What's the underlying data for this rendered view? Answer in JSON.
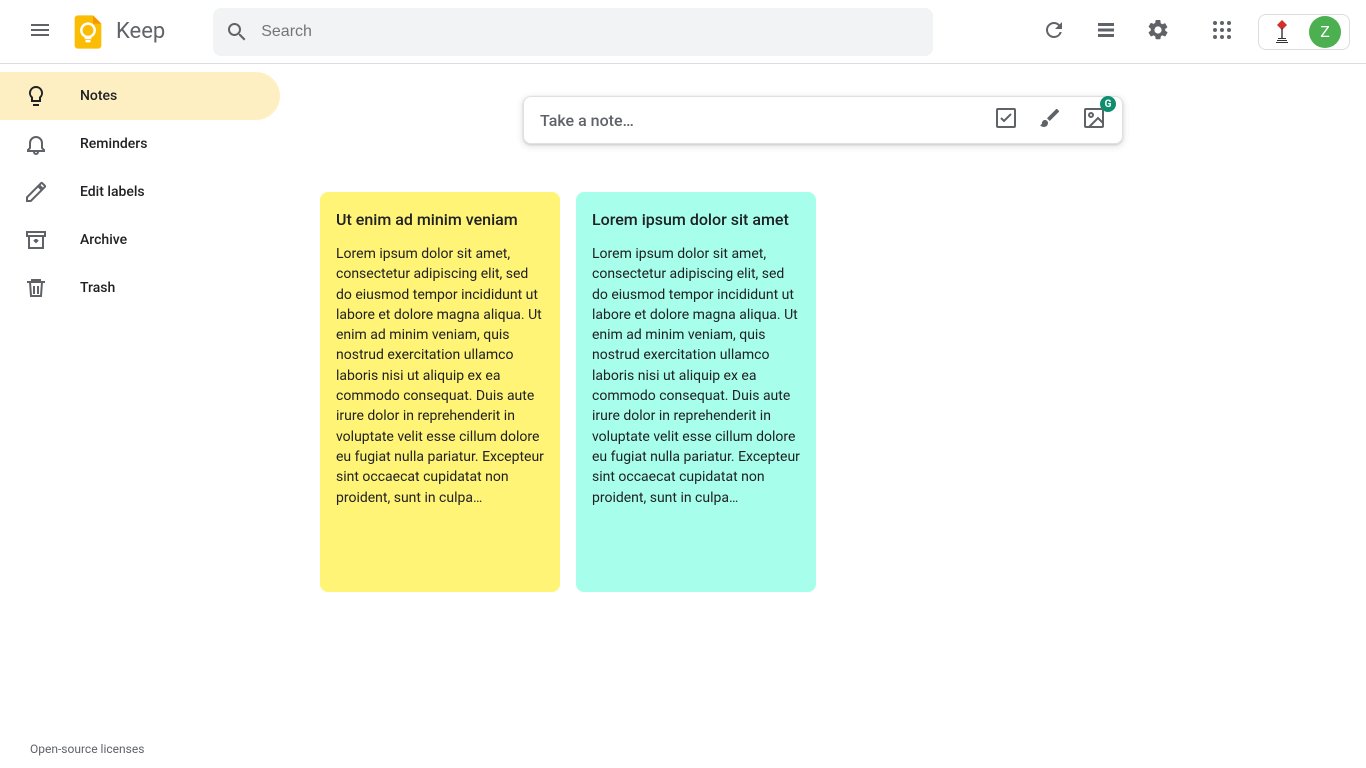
{
  "header": {
    "product_name": "Keep",
    "search_placeholder": "Search",
    "avatar_initial": "Z"
  },
  "sidebar": {
    "items": [
      {
        "label": "Notes"
      },
      {
        "label": "Reminders"
      },
      {
        "label": "Edit labels"
      },
      {
        "label": "Archive"
      },
      {
        "label": "Trash"
      }
    ],
    "footer": "Open-source licenses"
  },
  "take_note": {
    "placeholder": "Take a note…",
    "badge": "G"
  },
  "notes": [
    {
      "color": "yellow",
      "title": "Ut enim ad minim veniam",
      "body": "Lorem ipsum dolor sit amet, consectetur adipiscing elit, sed do eiusmod tempor incididunt ut labore et dolore magna aliqua. Ut enim ad minim veniam, quis nostrud exercitation ullamco laboris nisi ut aliquip ex ea commodo consequat. Duis aute irure dolor in reprehenderit in voluptate velit esse cillum dolore eu fugiat nulla pariatur. Excepteur sint occaecat cupidatat non proident, sunt in culpa…"
    },
    {
      "color": "teal",
      "title": "Lorem ipsum dolor sit amet",
      "body": "Lorem ipsum dolor sit amet, consectetur adipiscing elit, sed do eiusmod tempor incididunt ut labore et dolore magna aliqua. Ut enim ad minim veniam, quis nostrud exercitation ullamco laboris nisi ut aliquip ex ea commodo consequat. Duis aute irure dolor in reprehenderit in voluptate velit esse cillum dolore eu fugiat nulla pariatur. Excepteur sint occaecat cupidatat non proident, sunt in culpa…"
    }
  ]
}
